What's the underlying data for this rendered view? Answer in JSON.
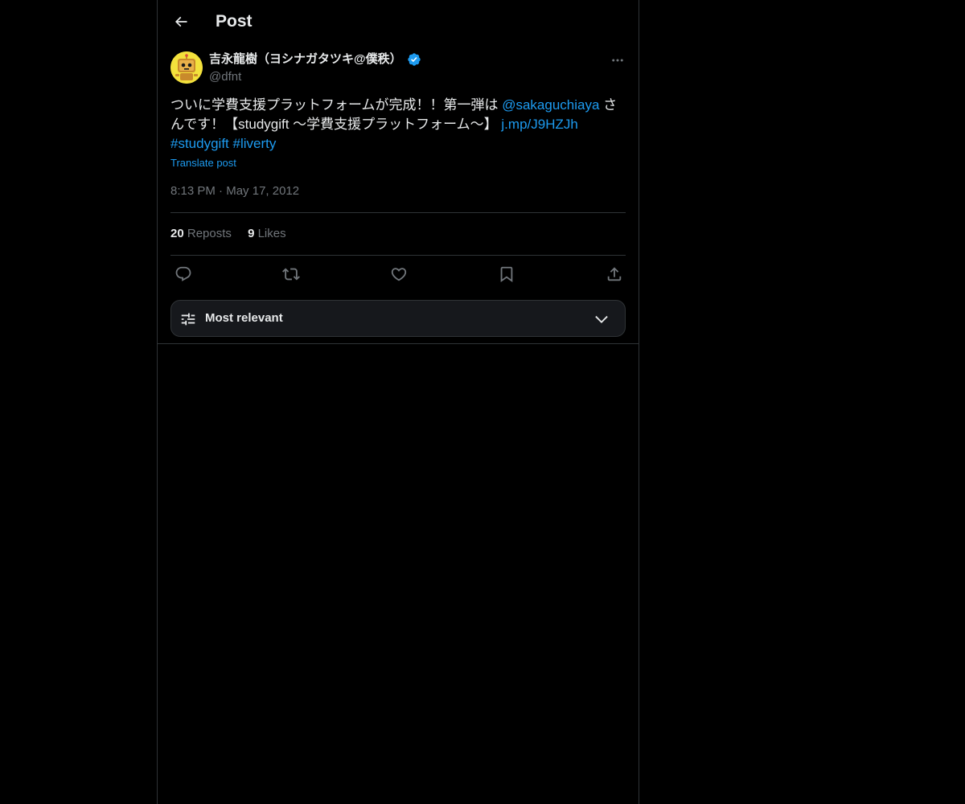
{
  "header": {
    "title": "Post",
    "back_icon": "arrow-left-icon"
  },
  "post": {
    "author": {
      "name": "吉永龍樹（ヨシナガタツキ@僕秩）",
      "handle": "@dfnt",
      "verified": true,
      "avatar_icon": "yellow-robot-avatar"
    },
    "text_parts": {
      "p1": "ついに学費支援プラットフォームが完成！！第一弾は ",
      "mention": "@sakaguchiaya",
      "p2": " さんです！【studygift 〜学費支援プラットフォーム〜】 ",
      "url": "j.mp/J9HZJh",
      "hashtag1": "#studygift",
      "hashtag2": "#liverty"
    },
    "translate_label": "Translate post",
    "time": "8:13 PM",
    "separator": "·",
    "date": "May 17, 2012",
    "stats": {
      "reposts_count": "20",
      "reposts_label": "Reposts",
      "likes_count": "9",
      "likes_label": "Likes"
    },
    "actions": [
      "reply-icon",
      "repost-icon",
      "like-icon",
      "bookmark-icon",
      "share-icon"
    ]
  },
  "replies_sort": {
    "label": "Most relevant",
    "icon": "sliders-icon",
    "chevron": "chevron-down-icon"
  },
  "colors": {
    "background": "#000000",
    "text": "#e7e9ea",
    "secondary_text": "#71767b",
    "link": "#1d9bf0",
    "border": "#2f3336",
    "verified": "#1d9bf0"
  }
}
